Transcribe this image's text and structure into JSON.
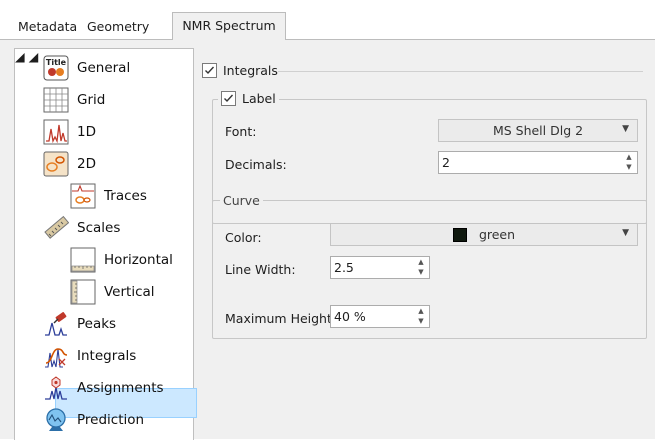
{
  "tabs": [
    "Metadata",
    "Geometry",
    "NMR Spectrum"
  ],
  "tree": {
    "items": [
      {
        "label": "General",
        "icon": "title-icon"
      },
      {
        "label": "Grid",
        "icon": "grid-icon"
      },
      {
        "label": "1D",
        "icon": "spectrum-1d-icon"
      },
      {
        "label": "2D",
        "icon": "spectrum-2d-icon"
      },
      {
        "label": "Traces",
        "icon": "traces-icon"
      },
      {
        "label": "Scales",
        "icon": "ruler-icon"
      },
      {
        "label": "Horizontal",
        "icon": "horizontal-scale-icon"
      },
      {
        "label": "Vertical",
        "icon": "vertical-scale-icon"
      },
      {
        "label": "Peaks",
        "icon": "peaks-icon"
      },
      {
        "label": "Integrals",
        "icon": "integrals-icon"
      },
      {
        "label": "Assignments",
        "icon": "assignments-icon"
      },
      {
        "label": "Prediction",
        "icon": "prediction-icon"
      }
    ],
    "selected": "Integrals"
  },
  "integrals": {
    "label": "Integrals",
    "checked": true,
    "label_group": {
      "label": "Label",
      "checked": true,
      "font_label": "Font:",
      "font_value": "MS Shell Dlg 2",
      "decimals_label": "Decimals:",
      "decimals_value": "2"
    },
    "curve_group": {
      "label": "Curve",
      "color_label": "Color:",
      "color_value": "green",
      "color_swatch": "#10190f",
      "line_width_label": "Line Width:",
      "line_width_value": "2.5",
      "max_height_label": "Maximum Height:",
      "max_height_value": "40 %"
    }
  }
}
